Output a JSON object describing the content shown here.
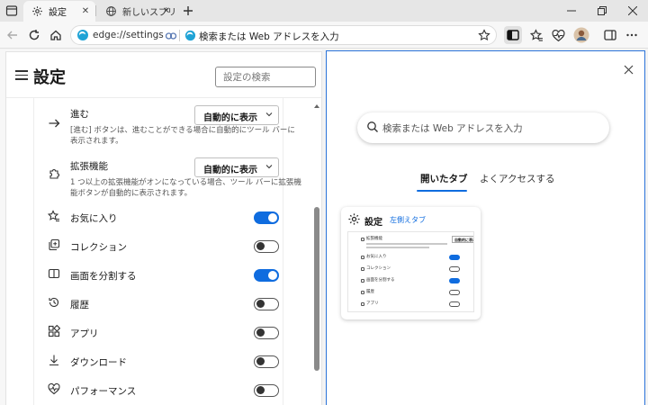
{
  "tabstrip": {
    "tabs": [
      {
        "label": "設定",
        "icon": "gear-icon",
        "active": true
      },
      {
        "label": "新しいスプリ",
        "icon": "globe-icon",
        "active": false
      }
    ]
  },
  "navbar": {
    "url": "edge://settings",
    "search_placeholder": "検索または Web アドレスを入力"
  },
  "settings": {
    "title": "設定",
    "search_placeholder": "設定の検索",
    "items": [
      {
        "label": "進む",
        "icon": "arrow-right-icon",
        "dropdown": "自動的に表示",
        "description": "[進む] ボタンは、進むことができる場合に自動的にツール バーに表示されます。"
      },
      {
        "label": "拡張機能",
        "icon": "puzzle-icon",
        "dropdown": "自動的に表示",
        "description": "1 つ以上の拡張機能がオンになっている場合、ツール バーに拡張機能ボタンが自動的に表示されます。"
      },
      {
        "label": "お気に入り",
        "icon": "star-list-icon",
        "toggle": true
      },
      {
        "label": "コレクション",
        "icon": "collections-icon",
        "toggle": false
      },
      {
        "label": "画面を分割する",
        "icon": "split-screen-icon",
        "toggle": true
      },
      {
        "label": "履歴",
        "icon": "history-icon",
        "toggle": false
      },
      {
        "label": "アプリ",
        "icon": "apps-icon",
        "toggle": false
      },
      {
        "label": "ダウンロード",
        "icon": "download-icon",
        "toggle": false
      },
      {
        "label": "パフォーマンス",
        "icon": "heartbeat-icon",
        "toggle": false
      }
    ]
  },
  "ntp": {
    "search_placeholder": "検索または Web アドレスを入力",
    "tabs": [
      "開いたタブ",
      "よくアクセスする"
    ],
    "card": {
      "title": "設定",
      "subtitle": "左側えタブ",
      "thumbnail": {
        "rows": [
          "拡張機能",
          "お気に入り",
          "コレクション",
          "画面を分割する",
          "履歴",
          "アプリ"
        ],
        "dropdown": "自動的に表示"
      }
    }
  },
  "colors": {
    "accent": "#0f6cdf",
    "pane_border": "#2a73d9"
  }
}
